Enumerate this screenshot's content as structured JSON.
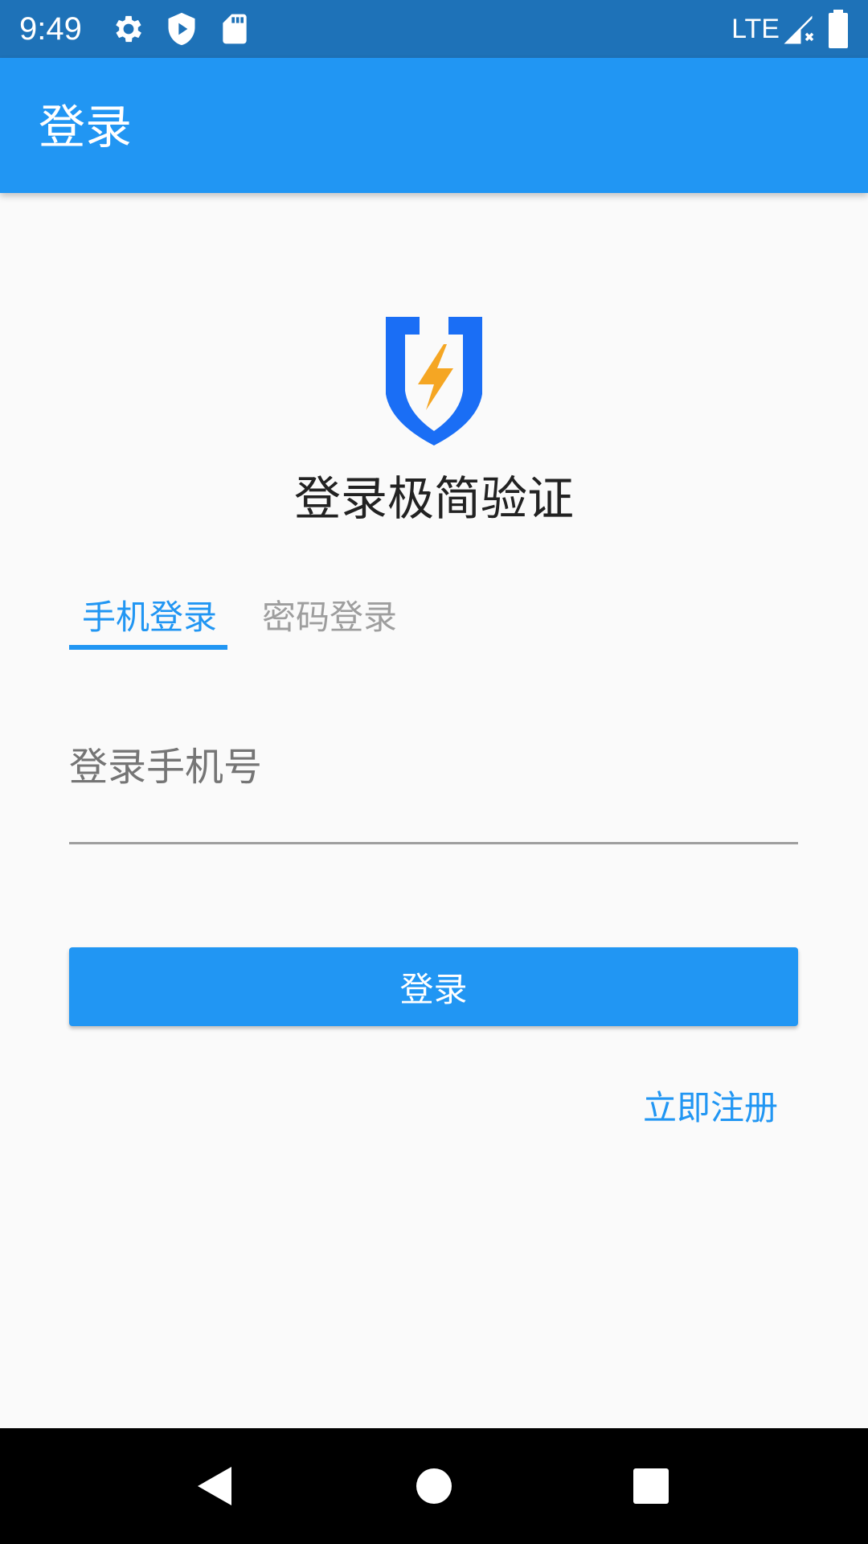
{
  "status_bar": {
    "time": "9:49",
    "network": "LTE",
    "icons": [
      "gear-icon",
      "play-protect-icon",
      "sd-card-icon",
      "signal-icon",
      "battery-icon"
    ]
  },
  "app_bar": {
    "title": "登录"
  },
  "brand": {
    "logo": "shield-lightning-logo",
    "title": "登录极简验证",
    "colors": {
      "shield": "#1a6ef5",
      "bolt": "#f5a623"
    }
  },
  "tabs": [
    {
      "label": "手机登录",
      "active": true
    },
    {
      "label": "密码登录",
      "active": false
    }
  ],
  "form": {
    "phone_placeholder": "登录手机号",
    "phone_value": "",
    "login_label": "登录"
  },
  "register_link": "立即注册",
  "nav_bar": {
    "icons": [
      "back-icon",
      "home-icon",
      "recents-icon"
    ]
  },
  "colors": {
    "primary": "#2196f3",
    "status_bar": "#1e72b8",
    "tab_inactive": "#9e9e9e",
    "background": "#fafafa"
  }
}
